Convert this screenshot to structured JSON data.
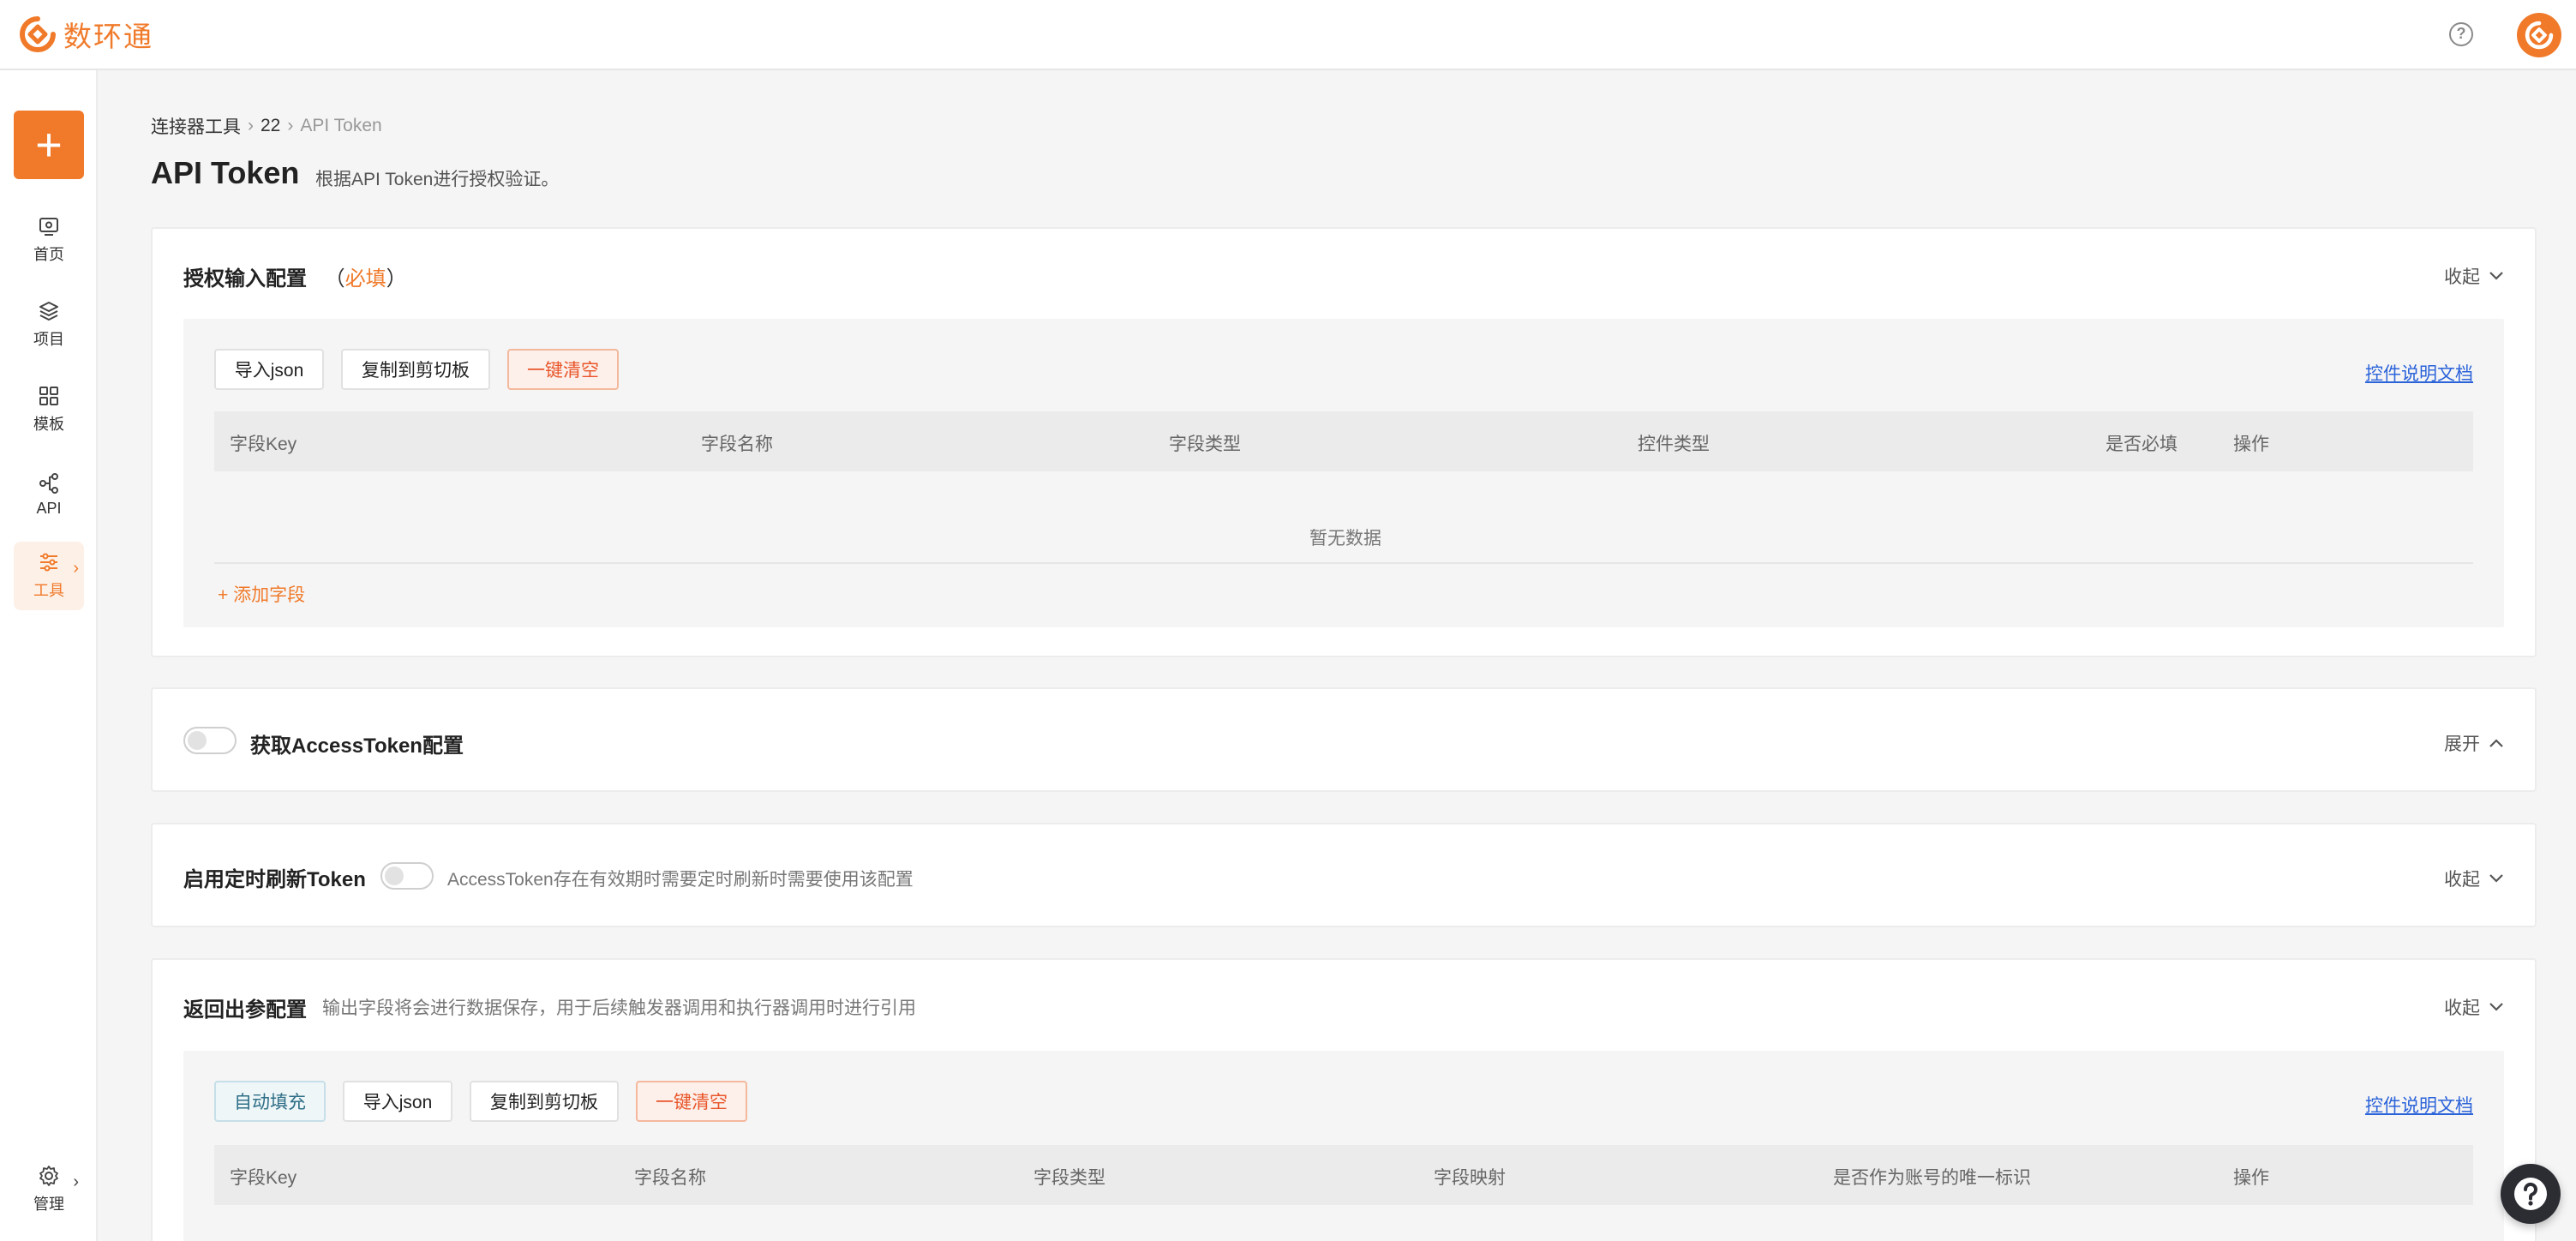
{
  "app": {
    "brand_name": "数环通",
    "brand_color": "#f07a2a"
  },
  "sidebar": {
    "new_button_label": "+",
    "items": [
      {
        "label": "首页",
        "icon": "monitor-icon"
      },
      {
        "label": "项目",
        "icon": "layers-icon"
      },
      {
        "label": "模板",
        "icon": "grid-icon"
      },
      {
        "label": "API",
        "icon": "api-icon"
      },
      {
        "label": "工具",
        "icon": "sliders-icon",
        "active": true
      },
      {
        "label": "管理",
        "icon": "gear-icon"
      }
    ]
  },
  "breadcrumb": [
    "连接器工具",
    "22",
    "API Token"
  ],
  "page": {
    "title": "API Token",
    "subtitle": "根据API Token进行授权验证。"
  },
  "auth_section": {
    "title": "授权输入配置",
    "required_open": "（",
    "required_word": "必填",
    "required_close": "）",
    "fold_label": "收起",
    "buttons": {
      "import": "导入json",
      "copy": "复制到剪切板",
      "clear": "一键清空"
    },
    "doc_link": "控件说明文档",
    "columns": [
      "字段Key",
      "字段名称",
      "字段类型",
      "控件类型",
      "是否必填",
      "操作"
    ],
    "empty_text": "暂无数据",
    "add_field": "+ 添加字段"
  },
  "access_token_section": {
    "title": "获取AccessToken配置",
    "toggle_on": false,
    "fold_label": "展开"
  },
  "refresh_section": {
    "title": "启用定时刷新Token",
    "toggle_on": false,
    "hint": "AccessToken存在有效期时需要定时刷新时需要使用该配置",
    "fold_label": "收起"
  },
  "output_section": {
    "title": "返回出参配置",
    "hint": "输出字段将会进行数据保存，用于后续触发器调用和执行器调用时进行引用",
    "fold_label": "收起",
    "buttons": {
      "auto": "自动填充",
      "import": "导入json",
      "copy": "复制到剪切板",
      "clear": "一键清空"
    },
    "doc_link": "控件说明文档",
    "columns": [
      "字段Key",
      "字段名称",
      "字段类型",
      "字段映射",
      "是否作为账号的唯一标识",
      "操作"
    ]
  }
}
